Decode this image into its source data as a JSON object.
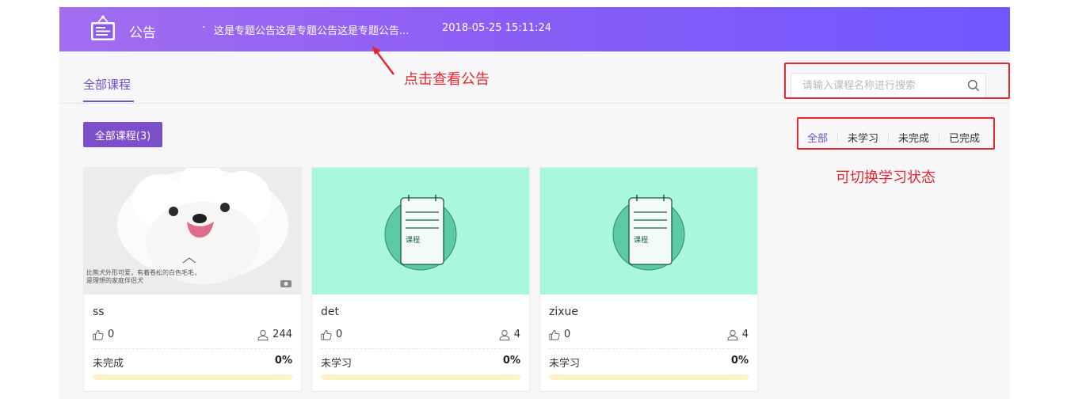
{
  "announcement": {
    "icon": "notice-board-icon",
    "title": "公告",
    "bullet": "·",
    "text": "这是专题公告这是专题公告这是专题公告...",
    "time": "2018-05-25 15:11:24"
  },
  "tabs": {
    "all_label": "全部课程"
  },
  "search": {
    "placeholder": "请输入课程名称进行搜索",
    "value": "",
    "icon": "search-icon"
  },
  "annotations": {
    "click_notice": "点击查看公告",
    "switch_status": "可切换学习状态"
  },
  "filter": {
    "count_label": "全部课程(3)",
    "statuses": [
      "全部",
      "未学习",
      "未完成",
      "已完成"
    ],
    "active_status": "全部"
  },
  "courses": [
    {
      "name": "ss",
      "likes": "0",
      "viewers": "244",
      "status": "未完成",
      "percent": "0%",
      "progress": 0,
      "cover": "dog-photo",
      "cover_caption": "比熊犬外形可爱，有着卷松的白色毛毛，\n是理想的家庭伴侣犬"
    },
    {
      "name": "det",
      "likes": "0",
      "viewers": "4",
      "status": "未学习",
      "percent": "0%",
      "progress": 0,
      "cover": "course-notebook-icon",
      "cover_label": "课程"
    },
    {
      "name": "zixue",
      "likes": "0",
      "viewers": "4",
      "status": "未学习",
      "percent": "0%",
      "progress": 0,
      "cover": "course-notebook-icon",
      "cover_label": "课程"
    }
  ],
  "colors": {
    "brand_purple": "#7b4fc9",
    "banner_start": "#a26df0",
    "banner_end": "#6f57ff",
    "cover_teal": "#aaf7e0",
    "annotation_red": "#e8272d",
    "progress_track": "#fdf3c6"
  }
}
